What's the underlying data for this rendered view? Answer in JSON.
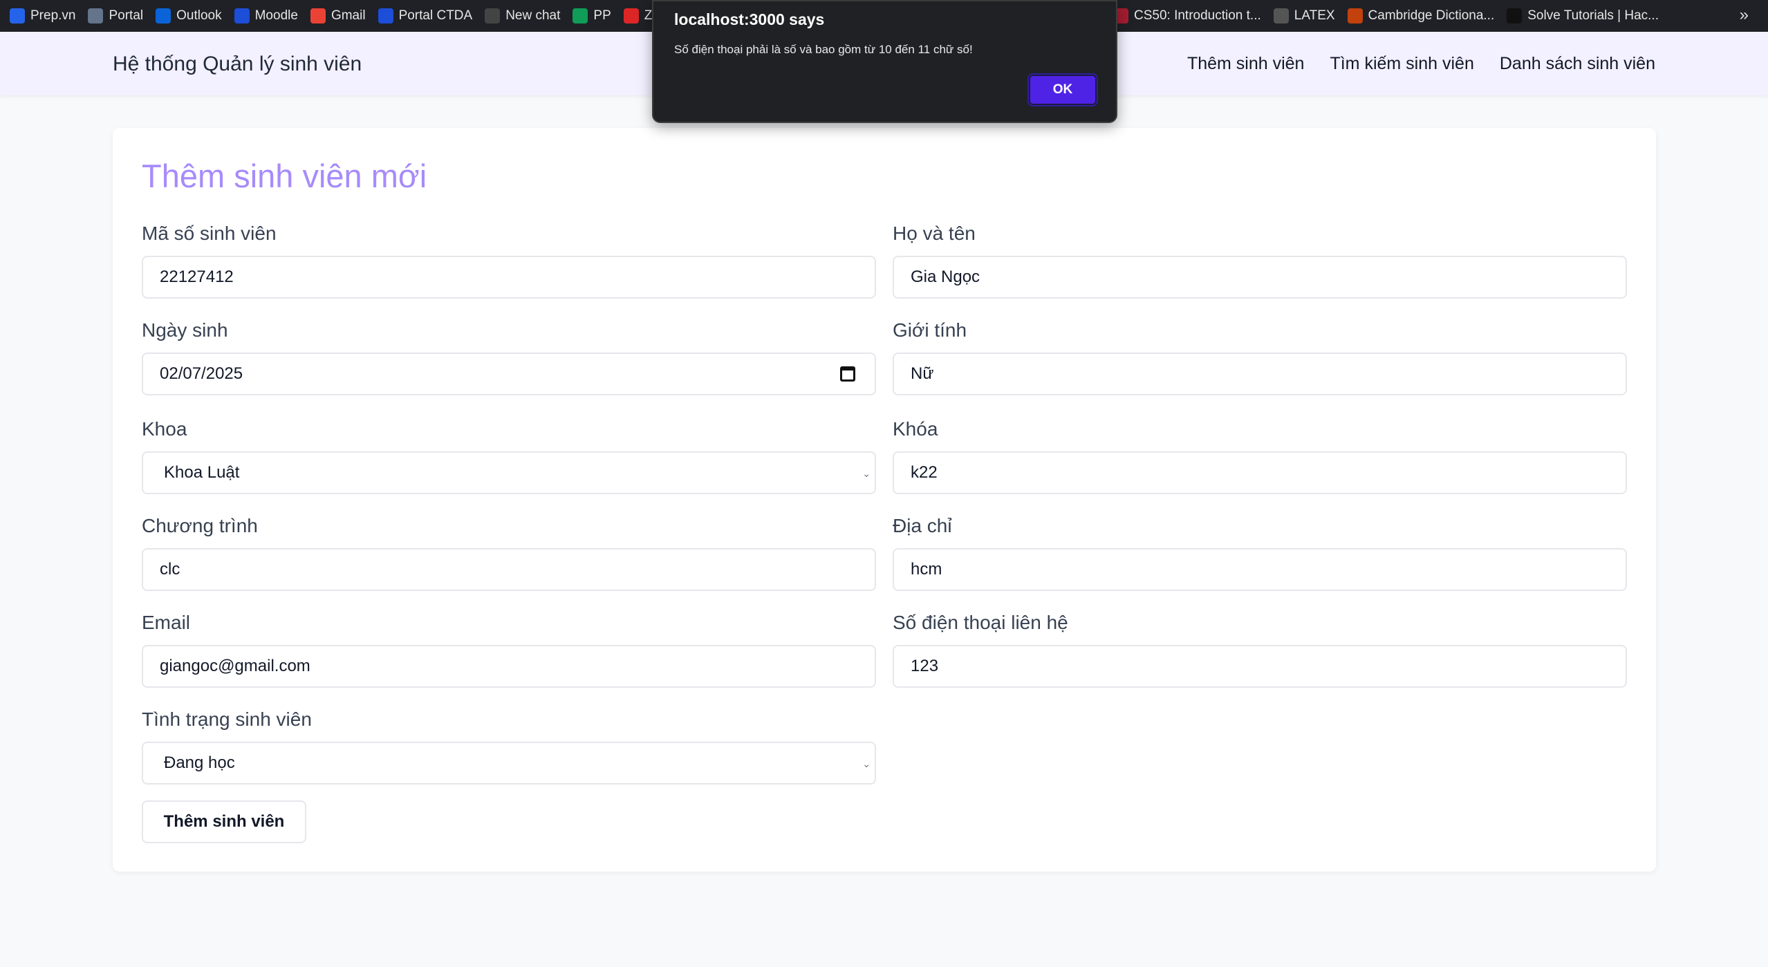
{
  "bookmarks": [
    {
      "label": "Prep.vn",
      "icon": "prep-icon",
      "color": "#2563eb"
    },
    {
      "label": "Portal",
      "icon": "portal-icon",
      "color": "#64748b"
    },
    {
      "label": "Outlook",
      "icon": "outlook-icon",
      "color": "#0a64d8"
    },
    {
      "label": "Moodle",
      "icon": "fit-icon",
      "color": "#1d4ed8"
    },
    {
      "label": "Gmail",
      "icon": "gmail-icon",
      "color": "#ea4335"
    },
    {
      "label": "Portal CTDA",
      "icon": "fit-icon",
      "color": "#1d4ed8"
    },
    {
      "label": "New chat",
      "icon": "chatgpt-icon",
      "color": "#444"
    },
    {
      "label": "PP",
      "icon": "drive-icon",
      "color": "#0f9d58"
    },
    {
      "label": "Z",
      "icon": "z-icon",
      "color": "#dc2626"
    }
  ],
  "bookmarks_right": [
    {
      "label": "CS50: Introduction t...",
      "icon": "cs50-icon",
      "color": "#a51c30"
    },
    {
      "label": "LATEX",
      "icon": "latex-icon",
      "color": "#555"
    },
    {
      "label": "Cambridge Dictiona...",
      "icon": "cambridge-icon",
      "color": "#c2410c"
    },
    {
      "label": "Solve Tutorials | Hac...",
      "icon": "hackerrank-icon",
      "color": "#111"
    }
  ],
  "more_bookmarks": "»",
  "navbar": {
    "brand": "Hệ thống Quản lý sinh viên",
    "links": [
      "Thêm sinh viên",
      "Tìm kiếm sinh viên",
      "Danh sách sinh viên"
    ]
  },
  "form": {
    "title": "Thêm sinh viên mới",
    "fields": {
      "mssv": {
        "label": "Mã số sinh viên",
        "value": "22127412"
      },
      "hoten": {
        "label": "Họ và tên",
        "value": "Gia Ngọc"
      },
      "ngaysinh": {
        "label": "Ngày sinh",
        "value": "02/07/2025"
      },
      "gioitinh": {
        "label": "Giới tính",
        "value": "Nữ"
      },
      "khoa": {
        "label": "Khoa",
        "value": "Khoa Luật"
      },
      "khoahoc": {
        "label": "Khóa",
        "value": "k22"
      },
      "chuongtrinh": {
        "label": "Chương trình",
        "value": "clc"
      },
      "diachi": {
        "label": "Địa chỉ",
        "value": "hcm"
      },
      "email": {
        "label": "Email",
        "value": "giangoc@gmail.com"
      },
      "sdt": {
        "label": "Số điện thoại liên hệ",
        "value": "123"
      },
      "tinhtrang": {
        "label": "Tình trạng sinh viên",
        "value": "Đang học"
      }
    },
    "submit_label": "Thêm sinh viên"
  },
  "dialog": {
    "title": "localhost:3000 says",
    "message": "Số điện thoại phải là số và bao gồm từ 10 đến 11 chữ số!",
    "ok_label": "OK"
  }
}
